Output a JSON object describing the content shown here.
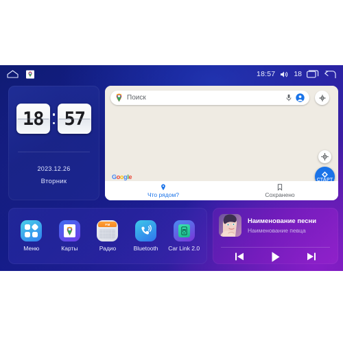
{
  "status_bar": {
    "home_icon": "home-icon",
    "notification_icon": "google-maps-notification-icon",
    "time": "18:57",
    "volume_icon": "volume-icon",
    "volume_level": "18",
    "recents_icon": "recents-icon",
    "back_icon": "back-icon"
  },
  "clock_widget": {
    "hours": "18",
    "minutes": "57",
    "date": "2023.12.26",
    "weekday": "Вторник"
  },
  "map_widget": {
    "search_placeholder": "Поиск",
    "pin_icon": "map-pin-icon",
    "mic_icon": "microphone-icon",
    "account_icon": "account-avatar-icon",
    "layers_icon": "map-layers-icon",
    "locate_icon": "my-location-icon",
    "start_button_label": "СТАРТ",
    "attribution": "Google",
    "bottom_nav": [
      {
        "label": "Что рядом?",
        "icon": "place-pin-icon",
        "active": true
      },
      {
        "label": "Сохранено",
        "icon": "bookmark-icon",
        "active": false
      }
    ]
  },
  "app_shelf": [
    {
      "label": "Меню",
      "icon": "apps-grid-icon"
    },
    {
      "label": "Карты",
      "icon": "google-maps-icon"
    },
    {
      "label": "Радио",
      "icon": "fm-radio-icon",
      "band": "FM"
    },
    {
      "label": "Bluetooth",
      "icon": "bluetooth-call-icon"
    },
    {
      "label": "Car Link 2.0",
      "icon": "car-link-icon"
    }
  ],
  "music_widget": {
    "title": "Наименование песни",
    "artist": "Наименование певца",
    "album_art": "album-art-portrait",
    "prev_icon": "skip-previous-icon",
    "play_icon": "play-icon",
    "next_icon": "skip-next-icon"
  },
  "colors": {
    "bg_blue": "#131a8c",
    "bg_purple": "#5c1aa8",
    "accent_blue": "#1a73e8",
    "map_bg": "#efebe3"
  }
}
